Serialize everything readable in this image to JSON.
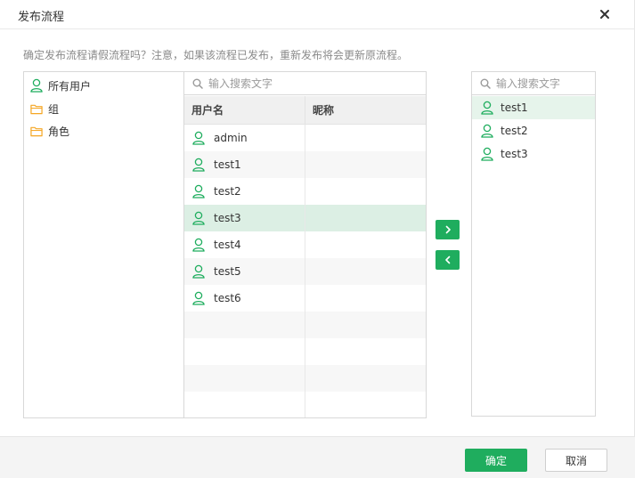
{
  "dialog": {
    "title": "发布流程",
    "notice": "确定发布流程请假流程吗？注意，如果该流程已发布，重新发布将会更新原流程。"
  },
  "tree": {
    "items": [
      {
        "label": "所有用户",
        "icon": "user-icon"
      },
      {
        "label": "组",
        "icon": "folder-icon"
      },
      {
        "label": "角色",
        "icon": "folder-icon"
      }
    ]
  },
  "user_table": {
    "search_placeholder": "输入搜索文字",
    "columns": [
      "用户名",
      "昵称"
    ],
    "rows": [
      {
        "username": "admin",
        "nickname": ""
      },
      {
        "username": "test1",
        "nickname": ""
      },
      {
        "username": "test2",
        "nickname": ""
      },
      {
        "username": "test3",
        "nickname": "",
        "selected": true
      },
      {
        "username": "test4",
        "nickname": ""
      },
      {
        "username": "test5",
        "nickname": ""
      },
      {
        "username": "test6",
        "nickname": ""
      }
    ]
  },
  "selected_panel": {
    "search_placeholder": "输入搜索文字",
    "items": [
      "test1",
      "test2",
      "test3"
    ]
  },
  "transfer": {
    "add_icon": "chevron-right-icon",
    "remove_icon": "chevron-left-icon"
  },
  "footer": {
    "ok_label": "确定",
    "cancel_label": "取消"
  },
  "colors": {
    "accent": "#1fad5e",
    "selected_row": "#dcefe4",
    "folder": "#f5a623"
  }
}
